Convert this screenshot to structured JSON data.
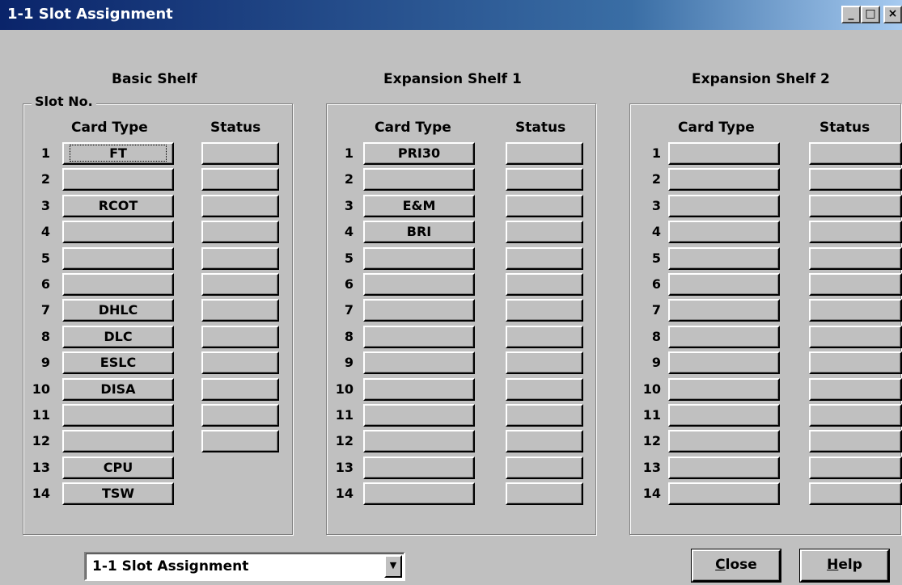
{
  "window": {
    "title": "1-1 Slot Assignment",
    "minimize_glyph": "_",
    "maximize_glyph": "□",
    "close_glyph": "×"
  },
  "labels": {
    "slot_no": "Slot No.",
    "card_type": "Card Type",
    "status": "Status"
  },
  "shelves": [
    {
      "title": "Basic Shelf",
      "slots": [
        {
          "num": "1",
          "card": "FT",
          "status": ""
        },
        {
          "num": "2",
          "card": "",
          "status": ""
        },
        {
          "num": "3",
          "card": "RCOT",
          "status": ""
        },
        {
          "num": "4",
          "card": "",
          "status": ""
        },
        {
          "num": "5",
          "card": "",
          "status": ""
        },
        {
          "num": "6",
          "card": "",
          "status": ""
        },
        {
          "num": "7",
          "card": "DHLC",
          "status": ""
        },
        {
          "num": "8",
          "card": "DLC",
          "status": ""
        },
        {
          "num": "9",
          "card": "ESLC",
          "status": ""
        },
        {
          "num": "10",
          "card": "DISA",
          "status": ""
        },
        {
          "num": "11",
          "card": "",
          "status": ""
        },
        {
          "num": "12",
          "card": "",
          "status": ""
        },
        {
          "num": "13",
          "card": "CPU"
        },
        {
          "num": "14",
          "card": "TSW"
        }
      ]
    },
    {
      "title": "Expansion Shelf 1",
      "slots": [
        {
          "num": "1",
          "card": "PRI30",
          "status": ""
        },
        {
          "num": "2",
          "card": "",
          "status": ""
        },
        {
          "num": "3",
          "card": "E&M",
          "status": ""
        },
        {
          "num": "4",
          "card": "BRI",
          "status": ""
        },
        {
          "num": "5",
          "card": "",
          "status": ""
        },
        {
          "num": "6",
          "card": "",
          "status": ""
        },
        {
          "num": "7",
          "card": "",
          "status": ""
        },
        {
          "num": "8",
          "card": "",
          "status": ""
        },
        {
          "num": "9",
          "card": "",
          "status": ""
        },
        {
          "num": "10",
          "card": "",
          "status": ""
        },
        {
          "num": "11",
          "card": "",
          "status": ""
        },
        {
          "num": "12",
          "card": "",
          "status": ""
        },
        {
          "num": "13",
          "card": "",
          "status": ""
        },
        {
          "num": "14",
          "card": "",
          "status": ""
        }
      ]
    },
    {
      "title": "Expansion Shelf 2",
      "slots": [
        {
          "num": "1",
          "card": "",
          "status": ""
        },
        {
          "num": "2",
          "card": "",
          "status": ""
        },
        {
          "num": "3",
          "card": "",
          "status": ""
        },
        {
          "num": "4",
          "card": "",
          "status": ""
        },
        {
          "num": "5",
          "card": "",
          "status": ""
        },
        {
          "num": "6",
          "card": "",
          "status": ""
        },
        {
          "num": "7",
          "card": "",
          "status": ""
        },
        {
          "num": "8",
          "card": "",
          "status": ""
        },
        {
          "num": "9",
          "card": "",
          "status": ""
        },
        {
          "num": "10",
          "card": "",
          "status": ""
        },
        {
          "num": "11",
          "card": "",
          "status": ""
        },
        {
          "num": "12",
          "card": "",
          "status": ""
        },
        {
          "num": "13",
          "card": "",
          "status": ""
        },
        {
          "num": "14",
          "card": "",
          "status": ""
        }
      ]
    }
  ],
  "footer": {
    "view_select": "1-1 Slot Assignment",
    "close_label": "Close",
    "close_mnemonic": "C",
    "close_rest": "lose",
    "help_label": "Help",
    "help_mnemonic": "H",
    "help_rest": "elp"
  },
  "colors": {
    "dialog_bg": "#c0c0c0",
    "titlebar_start": "#0a246a",
    "titlebar_end": "#a6caf0"
  }
}
